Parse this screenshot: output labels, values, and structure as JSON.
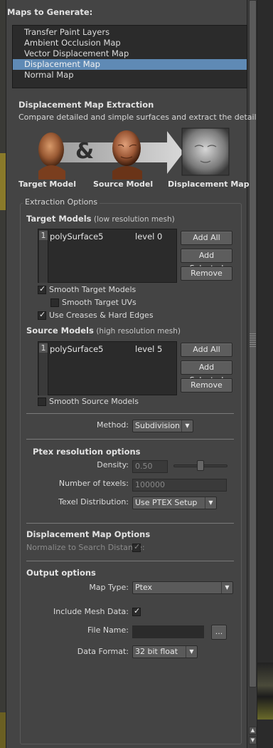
{
  "maps_to_generate": {
    "header": "Maps to Generate:",
    "items": [
      {
        "label": "Transfer Paint Layers",
        "selected": false
      },
      {
        "label": "Ambient Occlusion Map",
        "selected": false
      },
      {
        "label": "Vector Displacement Map",
        "selected": false
      },
      {
        "label": "Displacement Map",
        "selected": true
      },
      {
        "label": "Normal Map",
        "selected": false
      }
    ]
  },
  "extraction": {
    "title": "Displacement Map Extraction",
    "description": "Compare detailed and simple surfaces and extract the detail",
    "ampersand": "&",
    "images": {
      "target_label": "Target Model",
      "source_label": "Source Model",
      "result_label": "Displacement Map"
    }
  },
  "extraction_options": {
    "group_label": "Extraction Options",
    "target_models": {
      "title": "Target Models",
      "subtitle": "(low resolution mesh)",
      "rows": [
        {
          "index": "1",
          "name": "polySurface5",
          "level": "level 0"
        }
      ],
      "buttons": {
        "add_all": "Add All",
        "add_selected": "Add Selected",
        "remove": "Remove"
      },
      "smooth_target_models": {
        "label": "Smooth Target Models",
        "checked": true
      },
      "smooth_target_uvs": {
        "label": "Smooth Target UVs",
        "checked": false
      },
      "use_creases": {
        "label": "Use Creases & Hard Edges",
        "checked": true
      }
    },
    "source_models": {
      "title": "Source Models",
      "subtitle": "(high resolution mesh)",
      "rows": [
        {
          "index": "1",
          "name": "polySurface5",
          "level": "level 5"
        }
      ],
      "buttons": {
        "add_all": "Add All",
        "add_selected": "Add Selected",
        "remove": "Remove"
      },
      "smooth_source_models": {
        "label": "Smooth Source Models",
        "checked": false
      }
    },
    "method": {
      "label": "Method:",
      "value": "Subdivision"
    },
    "ptex": {
      "title": "Ptex resolution options",
      "density_label": "Density:",
      "density_value": "0.50",
      "density_slider_fraction": 0.5,
      "texels_label": "Number of texels:",
      "texels_value": "100000",
      "texel_distribution_label": "Texel Distribution:",
      "texel_distribution_value": "Use PTEX Setup"
    },
    "displacement_options": {
      "title": "Displacement Map Options",
      "normalize_label": "Normalize to Search Distance:",
      "normalize_checked": true
    },
    "output": {
      "title": "Output options",
      "map_type_label": "Map Type:",
      "map_type_value": "Ptex",
      "include_mesh_label": "Include Mesh Data:",
      "include_mesh_checked": true,
      "file_name_label": "File Name:",
      "file_name_value": "",
      "browse_label": "...",
      "data_format_label": "Data Format:",
      "data_format_value": "32 bit float"
    }
  },
  "check_glyph": "✓",
  "dropdown_arrow": "▼",
  "colors": {
    "panel_bg": "#444444",
    "list_bg": "#2b2b2b",
    "selection": "#5f8ab5",
    "button_bg": "#5d5d5d"
  }
}
